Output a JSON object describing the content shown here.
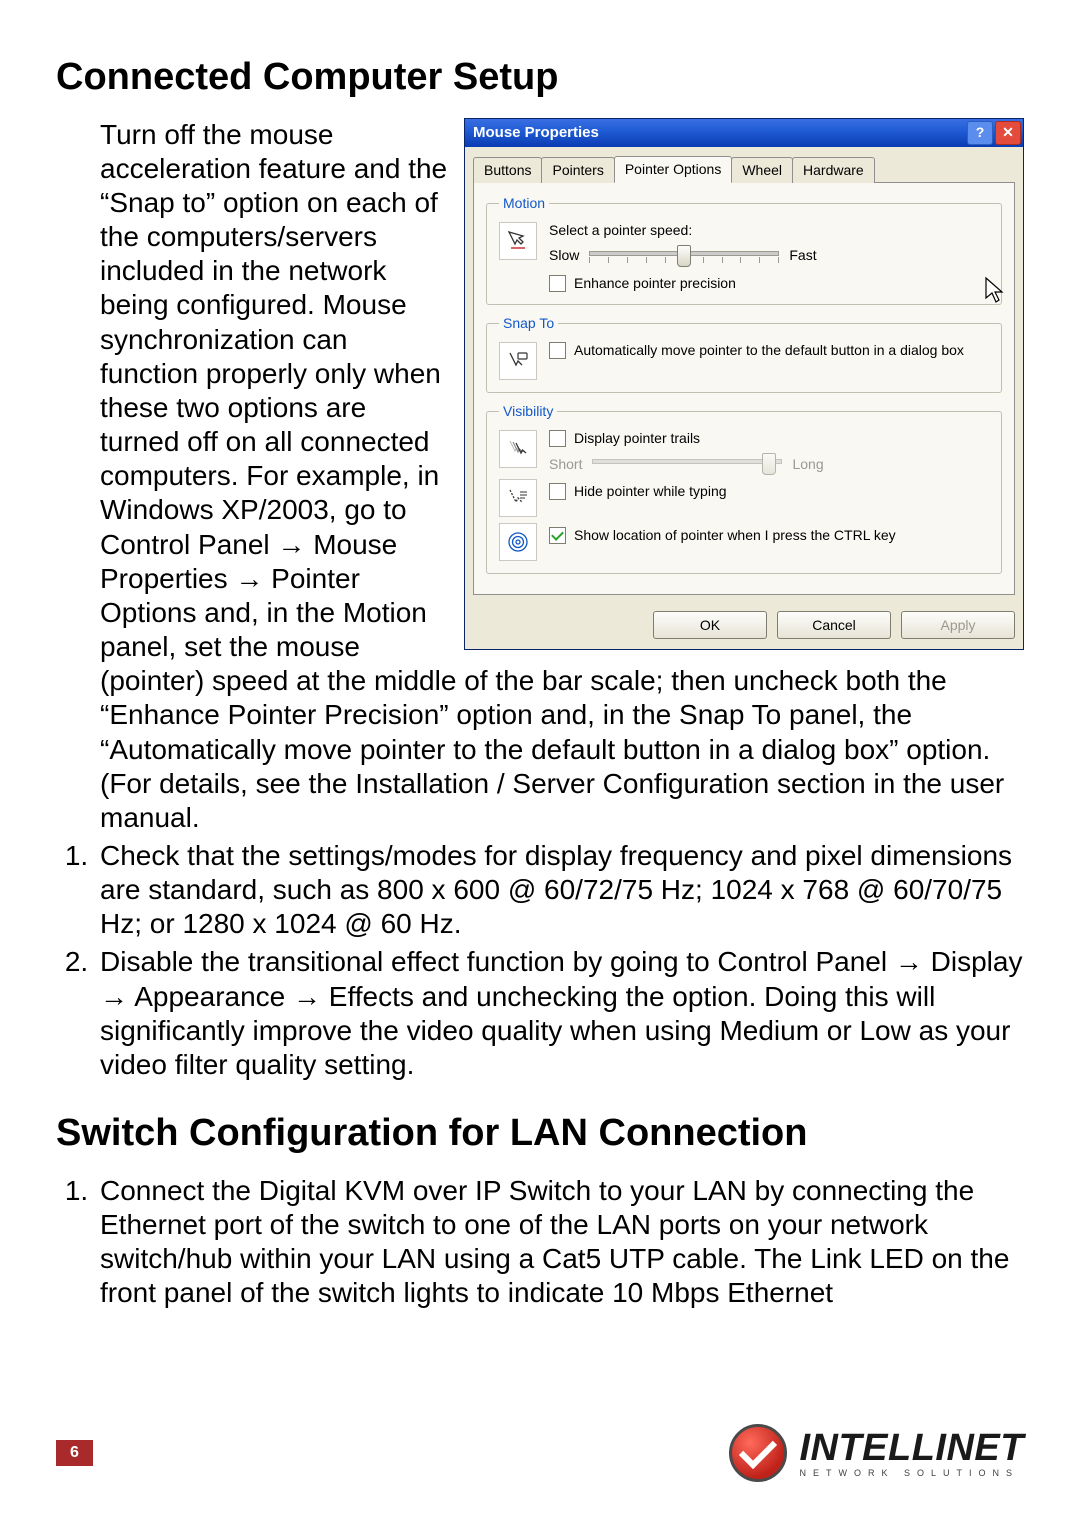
{
  "heading1": "Connected Computer Setup",
  "step1": "Turn off the mouse acceleration feature and the “Snap to” option on each of the computers/servers included in the network being configured. Mouse synchronization can function properly only when these two options are turned off on all connected computers. For example, in Windows XP/2003, go to Control Panel → Mouse Properties → Pointer Options and, in the Motion panel, set the mouse (pointer) speed at the middle of the bar scale; then uncheck both the “Enhance Pointer Precision” option and, in the Snap To panel, the “Automatically move pointer to the default button in a dialog box” option. (For details, see the Installation / Server Configuration section in the user manual.",
  "step2": "Check that the settings/modes for display frequency and pixel dimensions are standard, such as 800 x 600 @ 60/72/75 Hz; 1024 x 768 @ 60/70/75 Hz; or 1280 x 1024 @ 60 Hz.",
  "step3": "Disable the transitional effect function by going to Control Panel → Display → Appearance → Effects and unchecking the option. Doing this will significantly improve the video quality when using Medium or Low as your video filter quality setting.",
  "heading2": "Switch Configuration for LAN Connection",
  "step_lan1": "Connect the Digital KVM over IP Switch to your LAN by connecting the Ethernet port of the switch to one of the LAN ports on your network switch/hub within your LAN using a Cat5 UTP cable. The Link LED on the front panel of the switch lights to indicate 10 Mbps Ethernet",
  "dialog": {
    "title": "Mouse Properties",
    "tabs": [
      "Buttons",
      "Pointers",
      "Pointer Options",
      "Wheel",
      "Hardware"
    ],
    "motion": {
      "legend": "Motion",
      "label": "Select a pointer speed:",
      "slow": "Slow",
      "fast": "Fast",
      "enhance": "Enhance pointer precision"
    },
    "snap": {
      "legend": "Snap To",
      "label": "Automatically move pointer to the default button in a dialog box"
    },
    "visibility": {
      "legend": "Visibility",
      "trails": "Display pointer trails",
      "short": "Short",
      "long": "Long",
      "hide": "Hide pointer while typing",
      "ctrl": "Show location of pointer when I press the CTRL key"
    },
    "buttons": {
      "ok": "OK",
      "cancel": "Cancel",
      "apply": "Apply"
    }
  },
  "page_number": "6",
  "brand": {
    "name": "INTELLINET",
    "sub": "NETWORK SOLUTIONS"
  }
}
